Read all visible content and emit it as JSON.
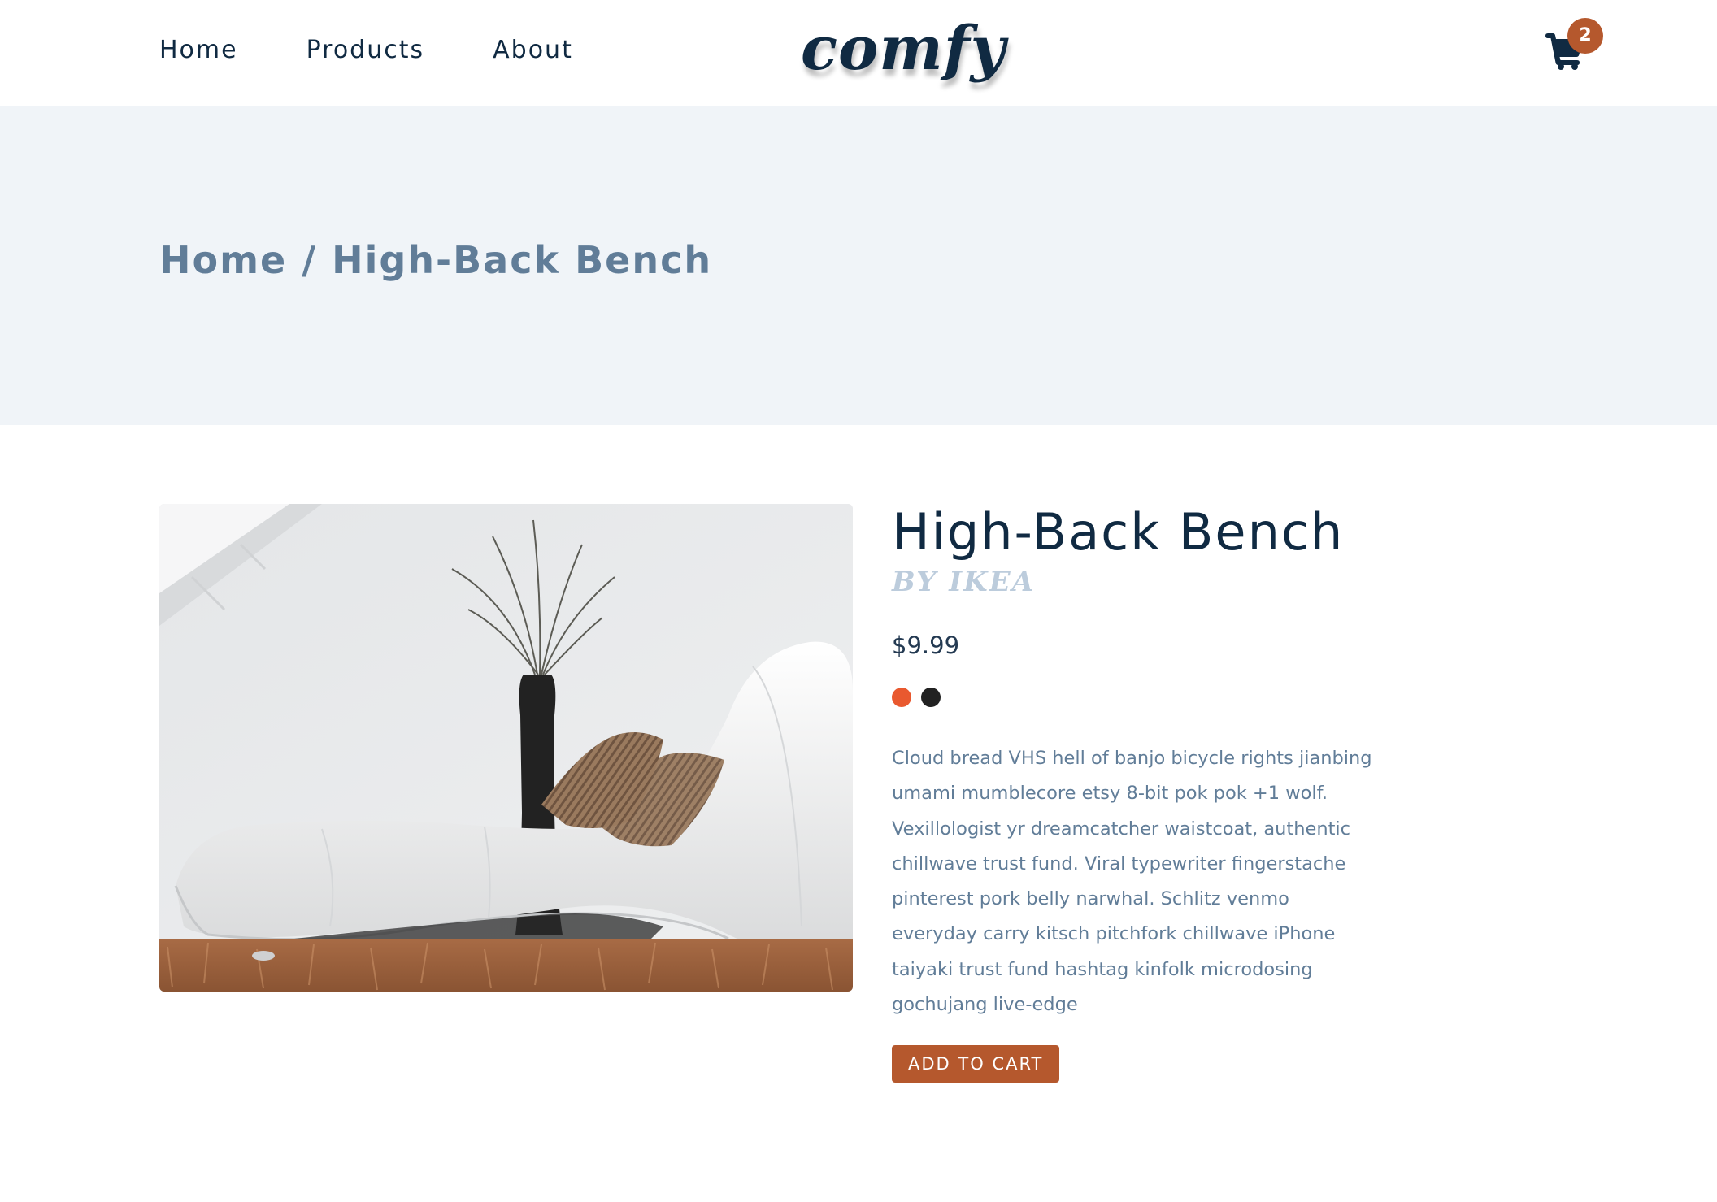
{
  "nav": {
    "links": [
      "Home",
      "Products",
      "About"
    ],
    "logo": "comfy",
    "cart_count": "2"
  },
  "breadcrumb": {
    "home": "Home",
    "separator": " / ",
    "current": "High-Back Bench"
  },
  "product": {
    "title": "High-Back Bench",
    "company": "BY IKEA",
    "price": "$9.99",
    "colors": [
      "#e9592f",
      "#222222"
    ],
    "description": "Cloud bread VHS hell of banjo bicycle rights jianbing umami mumblecore etsy 8-bit pok pok +1 wolf. Vexillologist yr dreamcatcher waistcoat, authentic chillwave trust fund. Viral typewriter fingerstache pinterest pork belly narwhal. Schlitz venmo everyday carry kitsch pitchfork chillwave iPhone taiyaki trust fund hashtag kinfolk microdosing gochujang live-edge",
    "add_to_cart_label": "ADD TO CART"
  },
  "colors": {
    "primary_dark": "#102a42",
    "accent": "#b5582d",
    "hero_bg": "#f0f4f8",
    "muted": "#617d98",
    "light_muted": "#bcccdc"
  },
  "icons": {
    "cart": "shopping-cart-icon"
  }
}
